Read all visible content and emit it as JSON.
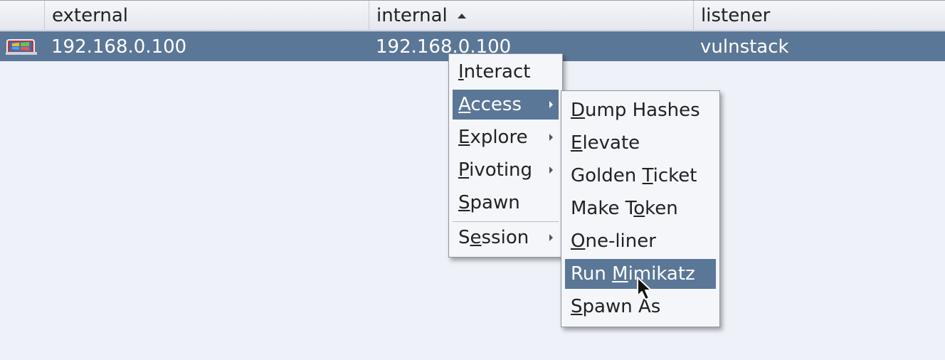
{
  "table": {
    "columns": [
      "",
      "external",
      "internal",
      "listener"
    ],
    "sorted_column": "internal",
    "rows": [
      {
        "icon": "windows-beacon-icon",
        "external": "192.168.0.100",
        "internal": "192.168.0.100",
        "listener": "vulnstack",
        "selected": true
      }
    ]
  },
  "context_menu": {
    "items": [
      {
        "label": "Interact",
        "mnemonic": "I",
        "submenu": false
      },
      {
        "label": "Access",
        "mnemonic": "A",
        "submenu": true,
        "highlighted": true
      },
      {
        "label": "Explore",
        "mnemonic": "E",
        "submenu": true
      },
      {
        "label": "Pivoting",
        "mnemonic": "P",
        "submenu": true
      },
      {
        "label": "Spawn",
        "mnemonic": "S",
        "submenu": false
      },
      {
        "label": "Session",
        "mnemonic": "e",
        "submenu": true
      }
    ]
  },
  "access_submenu": {
    "items": [
      {
        "label": "Dump Hashes",
        "mnemonic": "D"
      },
      {
        "label": "Elevate",
        "mnemonic": "E"
      },
      {
        "label": "Golden Ticket",
        "mnemonic": "T"
      },
      {
        "label": "Make Token",
        "mnemonic": "o"
      },
      {
        "label": "One-liner",
        "mnemonic": "O"
      },
      {
        "label": "Run Mimikatz",
        "mnemonic": "M",
        "highlighted": true
      },
      {
        "label": "Spawn As",
        "mnemonic": "S"
      }
    ]
  },
  "colors": {
    "selection": "#5b7797",
    "background": "#eef1f8",
    "menu_background": "#f4f6fa"
  }
}
